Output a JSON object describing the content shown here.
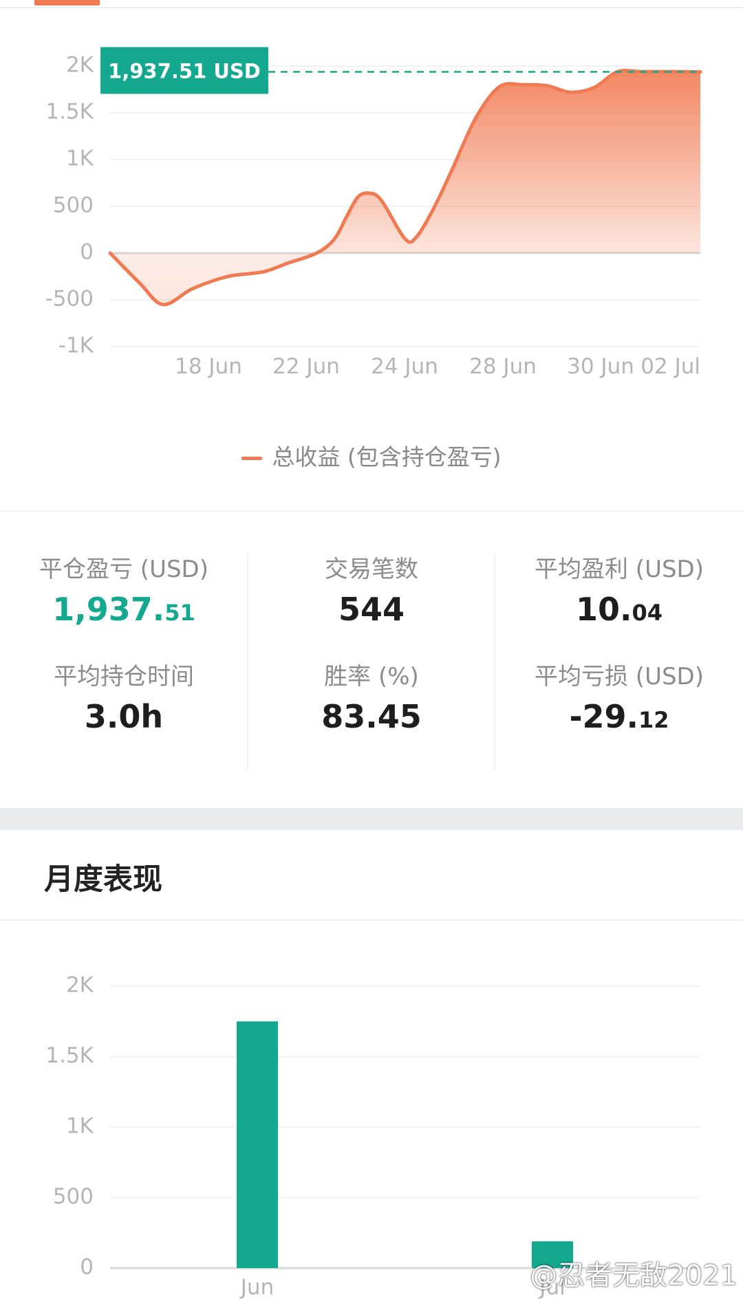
{
  "line_chart": {
    "chart_data": {
      "type": "area",
      "ylim": [
        -1000,
        2000
      ],
      "y_ticks": [
        "2K",
        "1.5K",
        "1K",
        "500",
        "0",
        "-500",
        "-1K"
      ],
      "x_ticks": [
        "18 Jun",
        "22 Jun",
        "24 Jun",
        "28 Jun",
        "30 Jun",
        "02 Jul"
      ],
      "series": [
        {
          "name": "总收益 (包含持仓盈亏)",
          "x": [
            0,
            0.05,
            0.09,
            0.14,
            0.2,
            0.26,
            0.3,
            0.35,
            0.38,
            0.4,
            0.42,
            0.44,
            0.46,
            0.5,
            0.52,
            0.55,
            0.58,
            0.62,
            0.66,
            0.7,
            0.74,
            0.78,
            0.82,
            0.86,
            0.9,
            0.95,
            1.0
          ],
          "y": [
            0,
            -320,
            -550,
            -380,
            -250,
            -200,
            -110,
            0,
            150,
            380,
            600,
            640,
            560,
            150,
            180,
            500,
            900,
            1450,
            1780,
            1800,
            1790,
            1720,
            1770,
            1940,
            1940,
            1940,
            1937
          ]
        }
      ],
      "annotation": "1,937.51 USD",
      "annotation_value": 1937.51,
      "line_color": "#f07a52",
      "accent_color": "#14a88f"
    }
  },
  "legend": {
    "label": "总收益 (包含持仓盈亏)"
  },
  "stats": {
    "closed_pnl_label": "平仓盈亏 (USD)",
    "closed_pnl_int": "1,937.",
    "closed_pnl_dec": "51",
    "trade_count_label": "交易笔数",
    "trade_count": "544",
    "avg_profit_label": "平均盈利 (USD)",
    "avg_profit_int": "10.",
    "avg_profit_dec": "04",
    "avg_hold_label": "平均持仓时间",
    "avg_hold": "3.0h",
    "win_rate_label": "胜率 (%)",
    "win_rate": "83.45",
    "avg_loss_label": "平均亏损 (USD)",
    "avg_loss_int": "-29.",
    "avg_loss_dec": "12"
  },
  "monthly": {
    "title": "月度表现",
    "chart_data": {
      "type": "bar",
      "categories": [
        "Jun",
        "Jul"
      ],
      "values": [
        1750,
        190
      ],
      "ylim": [
        0,
        2000
      ],
      "y_ticks": [
        "2K",
        "1.5K",
        "1K",
        "500",
        "0"
      ],
      "bar_color": "#14a88f"
    }
  },
  "watermark": "@忍者无敌2021"
}
